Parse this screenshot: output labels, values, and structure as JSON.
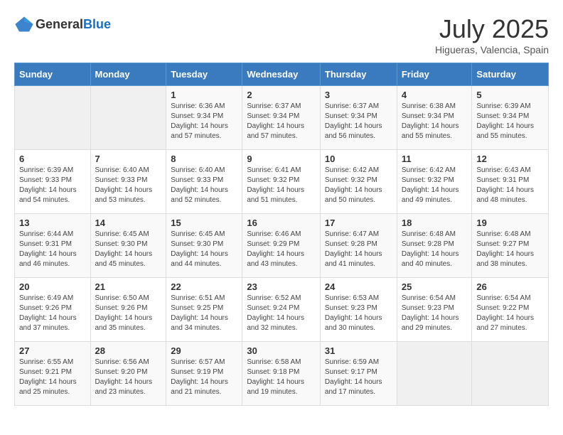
{
  "header": {
    "logo_general": "General",
    "logo_blue": "Blue",
    "month": "July 2025",
    "location": "Higueras, Valencia, Spain"
  },
  "weekdays": [
    "Sunday",
    "Monday",
    "Tuesday",
    "Wednesday",
    "Thursday",
    "Friday",
    "Saturday"
  ],
  "weeks": [
    [
      {
        "day": "",
        "sunrise": "",
        "sunset": "",
        "daylight": ""
      },
      {
        "day": "",
        "sunrise": "",
        "sunset": "",
        "daylight": ""
      },
      {
        "day": "1",
        "sunrise": "Sunrise: 6:36 AM",
        "sunset": "Sunset: 9:34 PM",
        "daylight": "Daylight: 14 hours and 57 minutes."
      },
      {
        "day": "2",
        "sunrise": "Sunrise: 6:37 AM",
        "sunset": "Sunset: 9:34 PM",
        "daylight": "Daylight: 14 hours and 57 minutes."
      },
      {
        "day": "3",
        "sunrise": "Sunrise: 6:37 AM",
        "sunset": "Sunset: 9:34 PM",
        "daylight": "Daylight: 14 hours and 56 minutes."
      },
      {
        "day": "4",
        "sunrise": "Sunrise: 6:38 AM",
        "sunset": "Sunset: 9:34 PM",
        "daylight": "Daylight: 14 hours and 55 minutes."
      },
      {
        "day": "5",
        "sunrise": "Sunrise: 6:39 AM",
        "sunset": "Sunset: 9:34 PM",
        "daylight": "Daylight: 14 hours and 55 minutes."
      }
    ],
    [
      {
        "day": "6",
        "sunrise": "Sunrise: 6:39 AM",
        "sunset": "Sunset: 9:33 PM",
        "daylight": "Daylight: 14 hours and 54 minutes."
      },
      {
        "day": "7",
        "sunrise": "Sunrise: 6:40 AM",
        "sunset": "Sunset: 9:33 PM",
        "daylight": "Daylight: 14 hours and 53 minutes."
      },
      {
        "day": "8",
        "sunrise": "Sunrise: 6:40 AM",
        "sunset": "Sunset: 9:33 PM",
        "daylight": "Daylight: 14 hours and 52 minutes."
      },
      {
        "day": "9",
        "sunrise": "Sunrise: 6:41 AM",
        "sunset": "Sunset: 9:32 PM",
        "daylight": "Daylight: 14 hours and 51 minutes."
      },
      {
        "day": "10",
        "sunrise": "Sunrise: 6:42 AM",
        "sunset": "Sunset: 9:32 PM",
        "daylight": "Daylight: 14 hours and 50 minutes."
      },
      {
        "day": "11",
        "sunrise": "Sunrise: 6:42 AM",
        "sunset": "Sunset: 9:32 PM",
        "daylight": "Daylight: 14 hours and 49 minutes."
      },
      {
        "day": "12",
        "sunrise": "Sunrise: 6:43 AM",
        "sunset": "Sunset: 9:31 PM",
        "daylight": "Daylight: 14 hours and 48 minutes."
      }
    ],
    [
      {
        "day": "13",
        "sunrise": "Sunrise: 6:44 AM",
        "sunset": "Sunset: 9:31 PM",
        "daylight": "Daylight: 14 hours and 46 minutes."
      },
      {
        "day": "14",
        "sunrise": "Sunrise: 6:45 AM",
        "sunset": "Sunset: 9:30 PM",
        "daylight": "Daylight: 14 hours and 45 minutes."
      },
      {
        "day": "15",
        "sunrise": "Sunrise: 6:45 AM",
        "sunset": "Sunset: 9:30 PM",
        "daylight": "Daylight: 14 hours and 44 minutes."
      },
      {
        "day": "16",
        "sunrise": "Sunrise: 6:46 AM",
        "sunset": "Sunset: 9:29 PM",
        "daylight": "Daylight: 14 hours and 43 minutes."
      },
      {
        "day": "17",
        "sunrise": "Sunrise: 6:47 AM",
        "sunset": "Sunset: 9:28 PM",
        "daylight": "Daylight: 14 hours and 41 minutes."
      },
      {
        "day": "18",
        "sunrise": "Sunrise: 6:48 AM",
        "sunset": "Sunset: 9:28 PM",
        "daylight": "Daylight: 14 hours and 40 minutes."
      },
      {
        "day": "19",
        "sunrise": "Sunrise: 6:48 AM",
        "sunset": "Sunset: 9:27 PM",
        "daylight": "Daylight: 14 hours and 38 minutes."
      }
    ],
    [
      {
        "day": "20",
        "sunrise": "Sunrise: 6:49 AM",
        "sunset": "Sunset: 9:26 PM",
        "daylight": "Daylight: 14 hours and 37 minutes."
      },
      {
        "day": "21",
        "sunrise": "Sunrise: 6:50 AM",
        "sunset": "Sunset: 9:26 PM",
        "daylight": "Daylight: 14 hours and 35 minutes."
      },
      {
        "day": "22",
        "sunrise": "Sunrise: 6:51 AM",
        "sunset": "Sunset: 9:25 PM",
        "daylight": "Daylight: 14 hours and 34 minutes."
      },
      {
        "day": "23",
        "sunrise": "Sunrise: 6:52 AM",
        "sunset": "Sunset: 9:24 PM",
        "daylight": "Daylight: 14 hours and 32 minutes."
      },
      {
        "day": "24",
        "sunrise": "Sunrise: 6:53 AM",
        "sunset": "Sunset: 9:23 PM",
        "daylight": "Daylight: 14 hours and 30 minutes."
      },
      {
        "day": "25",
        "sunrise": "Sunrise: 6:54 AM",
        "sunset": "Sunset: 9:23 PM",
        "daylight": "Daylight: 14 hours and 29 minutes."
      },
      {
        "day": "26",
        "sunrise": "Sunrise: 6:54 AM",
        "sunset": "Sunset: 9:22 PM",
        "daylight": "Daylight: 14 hours and 27 minutes."
      }
    ],
    [
      {
        "day": "27",
        "sunrise": "Sunrise: 6:55 AM",
        "sunset": "Sunset: 9:21 PM",
        "daylight": "Daylight: 14 hours and 25 minutes."
      },
      {
        "day": "28",
        "sunrise": "Sunrise: 6:56 AM",
        "sunset": "Sunset: 9:20 PM",
        "daylight": "Daylight: 14 hours and 23 minutes."
      },
      {
        "day": "29",
        "sunrise": "Sunrise: 6:57 AM",
        "sunset": "Sunset: 9:19 PM",
        "daylight": "Daylight: 14 hours and 21 minutes."
      },
      {
        "day": "30",
        "sunrise": "Sunrise: 6:58 AM",
        "sunset": "Sunset: 9:18 PM",
        "daylight": "Daylight: 14 hours and 19 minutes."
      },
      {
        "day": "31",
        "sunrise": "Sunrise: 6:59 AM",
        "sunset": "Sunset: 9:17 PM",
        "daylight": "Daylight: 14 hours and 17 minutes."
      },
      {
        "day": "",
        "sunrise": "",
        "sunset": "",
        "daylight": ""
      },
      {
        "day": "",
        "sunrise": "",
        "sunset": "",
        "daylight": ""
      }
    ]
  ]
}
